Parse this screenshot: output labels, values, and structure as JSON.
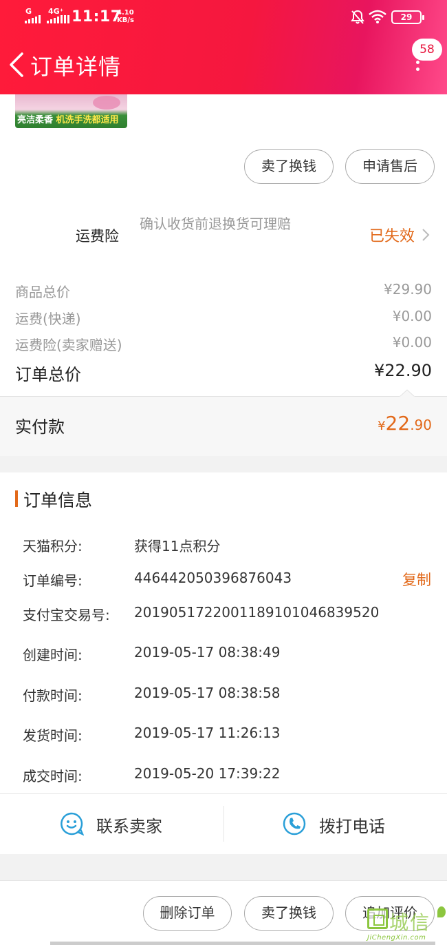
{
  "status_bar": {
    "network_1": "G",
    "network_2": "4G⁺",
    "time": "11:17",
    "speed_value": "4.10",
    "speed_unit": "KB/s",
    "battery": "29"
  },
  "header": {
    "title": "订单详情",
    "badge_count": "58",
    "accent_color": "#f5173f"
  },
  "product_thumb": {
    "caption_a": "亮洁柔香",
    "caption_b": "机洗手洗都适用"
  },
  "top_actions": {
    "sell_label": "卖了换钱",
    "after_sale_label": "申请售后"
  },
  "shipping_insurance": {
    "label": "运费险",
    "description": "确认收货前退换货可理赔",
    "status": "已失效"
  },
  "pricing": {
    "rows": [
      {
        "label": "商品总价",
        "value": "¥29.90"
      },
      {
        "label": "运费(快递)",
        "value": "¥0.00"
      },
      {
        "label": "运费险(卖家赠送)",
        "value": "¥0.00"
      }
    ],
    "total_label": "订单总价",
    "total_value": "¥22.90",
    "paid_label": "实付款",
    "paid_currency": "¥",
    "paid_integer": "22",
    "paid_decimal": ".90"
  },
  "order_info": {
    "title": "订单信息",
    "copy_label": "复制",
    "rows": [
      {
        "label": "天猫积分:",
        "value": "获得11点积分"
      },
      {
        "label": "订单编号:",
        "value": "446442050396876043"
      },
      {
        "label": "支付宝交易号:",
        "value": "2019051722001189101046839520"
      },
      {
        "label": "创建时间:",
        "value": "2019-05-17 08:38:49"
      },
      {
        "label": "付款时间:",
        "value": "2019-05-17 08:38:58"
      },
      {
        "label": "发货时间:",
        "value": "2019-05-17 11:26:13"
      },
      {
        "label": "成交时间:",
        "value": "2019-05-20 17:39:22"
      }
    ]
  },
  "contact": {
    "seller_label": "联系卖家",
    "call_label": "拨打电话"
  },
  "bottom_actions": {
    "delete_label": "删除订单",
    "sell_label": "卖了换钱",
    "review_label": "追加评价"
  },
  "watermark": {
    "text": "城信",
    "url": "JiChengXin.com"
  },
  "colors": {
    "orange": "#e2691a",
    "blue_icon": "#2a9fd8"
  }
}
